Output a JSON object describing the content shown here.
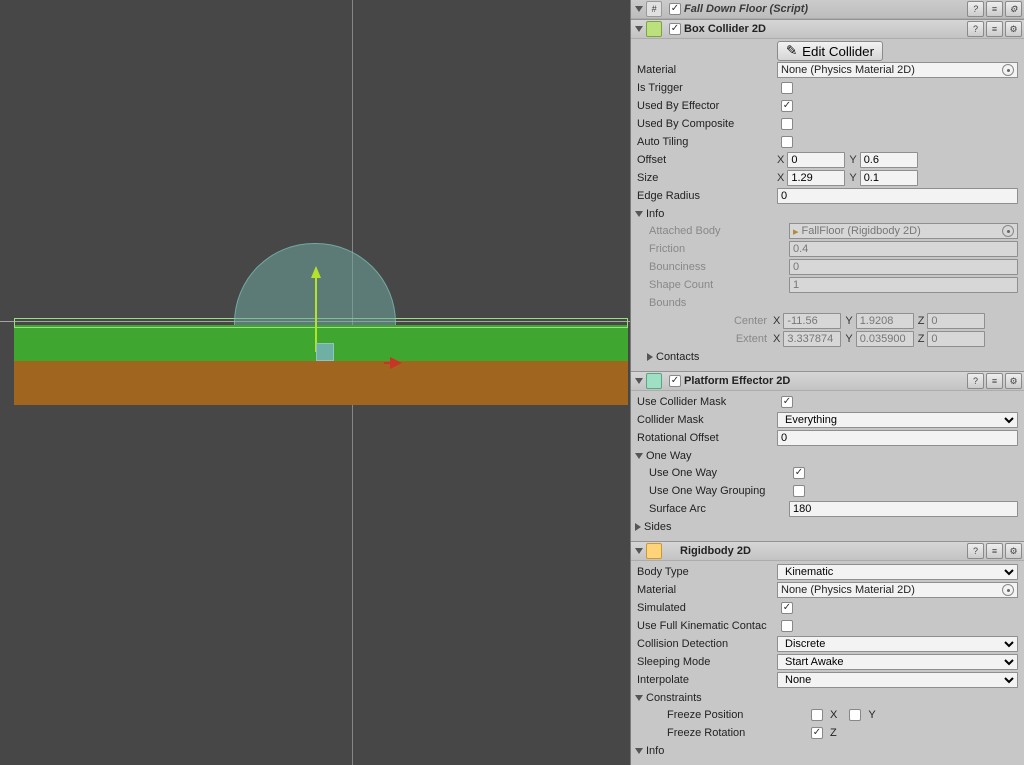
{
  "script": {
    "title": "Fall Down Floor (Script)"
  },
  "boxCollider": {
    "title": "Box Collider 2D",
    "editBtn": "Edit Collider",
    "labels": {
      "material": "Material",
      "isTrigger": "Is Trigger",
      "usedByEffector": "Used By Effector",
      "usedByComposite": "Used By Composite",
      "autoTiling": "Auto Tiling",
      "offset": "Offset",
      "size": "Size",
      "edgeRadius": "Edge Radius"
    },
    "material": "None (Physics Material 2D)",
    "isTrigger": false,
    "usedByEffector": true,
    "usedByComposite": false,
    "autoTiling": false,
    "offset": {
      "x": "0",
      "y": "0.6"
    },
    "size": {
      "x": "1.29",
      "y": "0.1"
    },
    "edgeRadius": "0",
    "info": {
      "title": "Info",
      "attachedBodyLabel": "Attached Body",
      "attachedBody": "FallFloor (Rigidbody 2D)",
      "frictionLabel": "Friction",
      "friction": "0.4",
      "bouncinessLabel": "Bounciness",
      "bounciness": "0",
      "shapeCountLabel": "Shape Count",
      "shapeCount": "1",
      "boundsLabel": "Bounds",
      "centerLabel": "Center",
      "center": {
        "x": "-11.56",
        "y": "1.9208",
        "z": "0"
      },
      "extentLabel": "Extent",
      "extent": {
        "x": "3.337874",
        "y": "0.035900",
        "z": "0"
      },
      "contactsLabel": "Contacts"
    }
  },
  "platformEffector": {
    "title": "Platform Effector 2D",
    "useColliderMaskLabel": "Use Collider Mask",
    "useColliderMask": true,
    "colliderMaskLabel": "Collider Mask",
    "colliderMask": "Everything",
    "rotationalOffsetLabel": "Rotational Offset",
    "rotationalOffset": "0",
    "oneWay": {
      "title": "One Way",
      "useOneWayLabel": "Use One Way",
      "useOneWay": true,
      "useGroupingLabel": "Use One Way Grouping",
      "useGrouping": false,
      "surfaceArcLabel": "Surface Arc",
      "surfaceArc": "180"
    },
    "sidesLabel": "Sides"
  },
  "rigidbody": {
    "title": "Rigidbody 2D",
    "bodyTypeLabel": "Body Type",
    "bodyType": "Kinematic",
    "materialLabel": "Material",
    "material": "None (Physics Material 2D)",
    "simulatedLabel": "Simulated",
    "simulated": true,
    "useFullKinLabel": "Use Full Kinematic Contac",
    "useFullKin": false,
    "collisionDetLabel": "Collision Detection",
    "collisionDet": "Discrete",
    "sleepingLabel": "Sleeping Mode",
    "sleeping": "Start Awake",
    "interpolateLabel": "Interpolate",
    "interpolate": "None",
    "constraints": {
      "title": "Constraints",
      "freezePosLabel": "Freeze Position",
      "freezePosX": false,
      "freezePosY": false,
      "x": "X",
      "y": "Y",
      "freezeRotLabel": "Freeze Rotation",
      "freezeRotZ": true,
      "z": "Z"
    },
    "infoLabel": "Info"
  },
  "axes": {
    "x": "X",
    "y": "Y",
    "z": "Z"
  }
}
